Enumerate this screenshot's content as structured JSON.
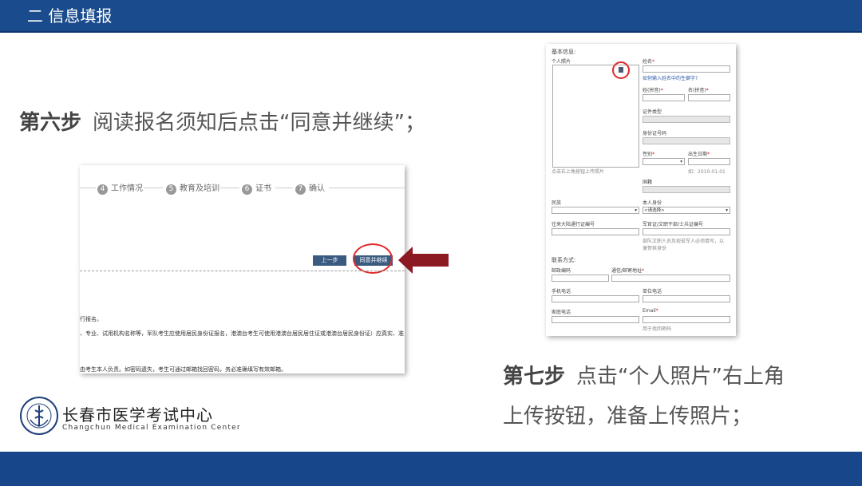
{
  "header": {
    "title": "二  信息填报"
  },
  "step6": {
    "label": "第六步",
    "text": "阅读报名须知后点击“同意并继续”；"
  },
  "step7": {
    "label": "第七步",
    "line1": "点击“个人照片”右上角",
    "line2": "上传按钮，准备上传照片；"
  },
  "progress_steps": [
    {
      "num": "4",
      "label": "工作情况"
    },
    {
      "num": "5",
      "label": "教育及培训"
    },
    {
      "num": "6",
      "label": "证书"
    },
    {
      "num": "7",
      "label": "确认"
    }
  ],
  "buttons": {
    "prev": "上一步",
    "agree": "同意并继续"
  },
  "notice_lines": [
    "行报名。",
    "、专业、试用机构名称等，军队考生应使用居民身份证报名，港澳台考生可使用港澳台居民居住证或港澳台居民身份证）应真实、准",
    "由考生本人负责。如密码遗失，考生可通过邮箱找回密码，务必准确填写有效邮箱。"
  ],
  "form": {
    "basic_info": "基本信息:",
    "photo_label": "个人照片",
    "photo_hint": "点击右上角按钮上传照片",
    "name_label": "姓名",
    "name_help": "如何输入姓名中的生僻字?",
    "surname_pinyin": "姓(拼音)",
    "given_pinyin": "名(拼音)",
    "id_type": "证件类型",
    "id_number": "身份证号码",
    "gender": "性别",
    "birthdate": "出生日期",
    "birthdate_hint": "如：2010-01-01",
    "nationality": "国籍",
    "ethnicity": "民族",
    "identity": "本人身份",
    "identity_value": "<请选择>",
    "mainland_permit": "往来大陆通行证编号",
    "military_id": "军官证/文职干部/士兵证编号",
    "military_hint1": "部队文职人员及现役军人必须填写，以",
    "military_hint2": "便贺核身份",
    "contact": "联系方式:",
    "postcode": "邮政编码",
    "address": "通信/邮寄地址",
    "mobile": "手机电话",
    "work_phone": "单位电话",
    "home_phone": "家庭电话",
    "email": "Email",
    "email_hint": "用于找回密码"
  },
  "logo": {
    "cn": "长春市医学考试中心",
    "en": "Changchun Medical Examination Center",
    "seal_text": "CHANGCHUN MEDICAL EXAMINATION"
  },
  "colors": {
    "header_bg": "#1a4b8c",
    "accent_red": "#e0282a",
    "arrow": "#8b1a22",
    "button": "#3a5a80"
  }
}
